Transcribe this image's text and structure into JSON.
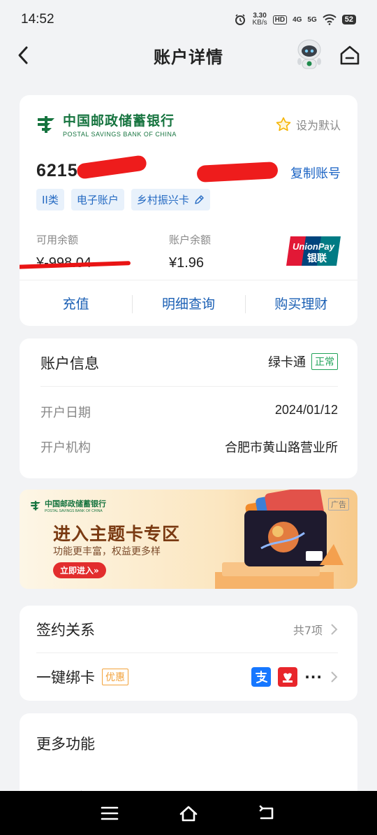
{
  "status_bar": {
    "time": "14:52",
    "net_speed_value": "3.30",
    "net_speed_unit": "KB/s",
    "hd_label": "HD",
    "sim1": "4G",
    "sim2": "5G",
    "battery": "52"
  },
  "navbar": {
    "title": "账户详情"
  },
  "account_card": {
    "bank_name_cn": "中国邮政储蓄银行",
    "bank_name_en": "POSTAL SAVINGS BANK OF CHINA",
    "set_default_label": "设为默认",
    "card_number_masked": "6215     **** **",
    "copy_label": "复制账号",
    "tags": [
      "II类",
      "电子账户",
      "乡村振兴卡"
    ],
    "available_label": "可用余额",
    "available_value": "¥-998.04",
    "balance_label": "账户余额",
    "balance_value": "¥1.96",
    "unionpay_en": "UnionPay",
    "unionpay_cn": "银联",
    "actions": [
      "充值",
      "明细查询",
      "购买理财"
    ]
  },
  "account_info": {
    "title": "账户信息",
    "card_type": "绿卡通",
    "status": "正常",
    "rows": [
      {
        "key": "开户日期",
        "value": "2024/01/12"
      },
      {
        "key": "开户机构",
        "value": "合肥市黄山路营业所"
      }
    ]
  },
  "banner": {
    "bank_name_cn": "中国邮政储蓄银行",
    "bank_name_en": "POSTAL SAVINGS BANK OF CHINA",
    "ad_label": "广告",
    "title": "进入主题卡专区",
    "subtitle": "功能更丰富，权益更多样",
    "button": "立即进入»"
  },
  "sign": {
    "contract_label": "签约关系",
    "contract_count": "共7项",
    "bind_label": "一键绑卡",
    "promo_label": "优惠",
    "more_dots": "···"
  },
  "more": {
    "title": "更多功能"
  },
  "colors": {
    "brand_green": "#16743f",
    "link_blue": "#1a63c4",
    "redaction": "#ee1c1c"
  }
}
